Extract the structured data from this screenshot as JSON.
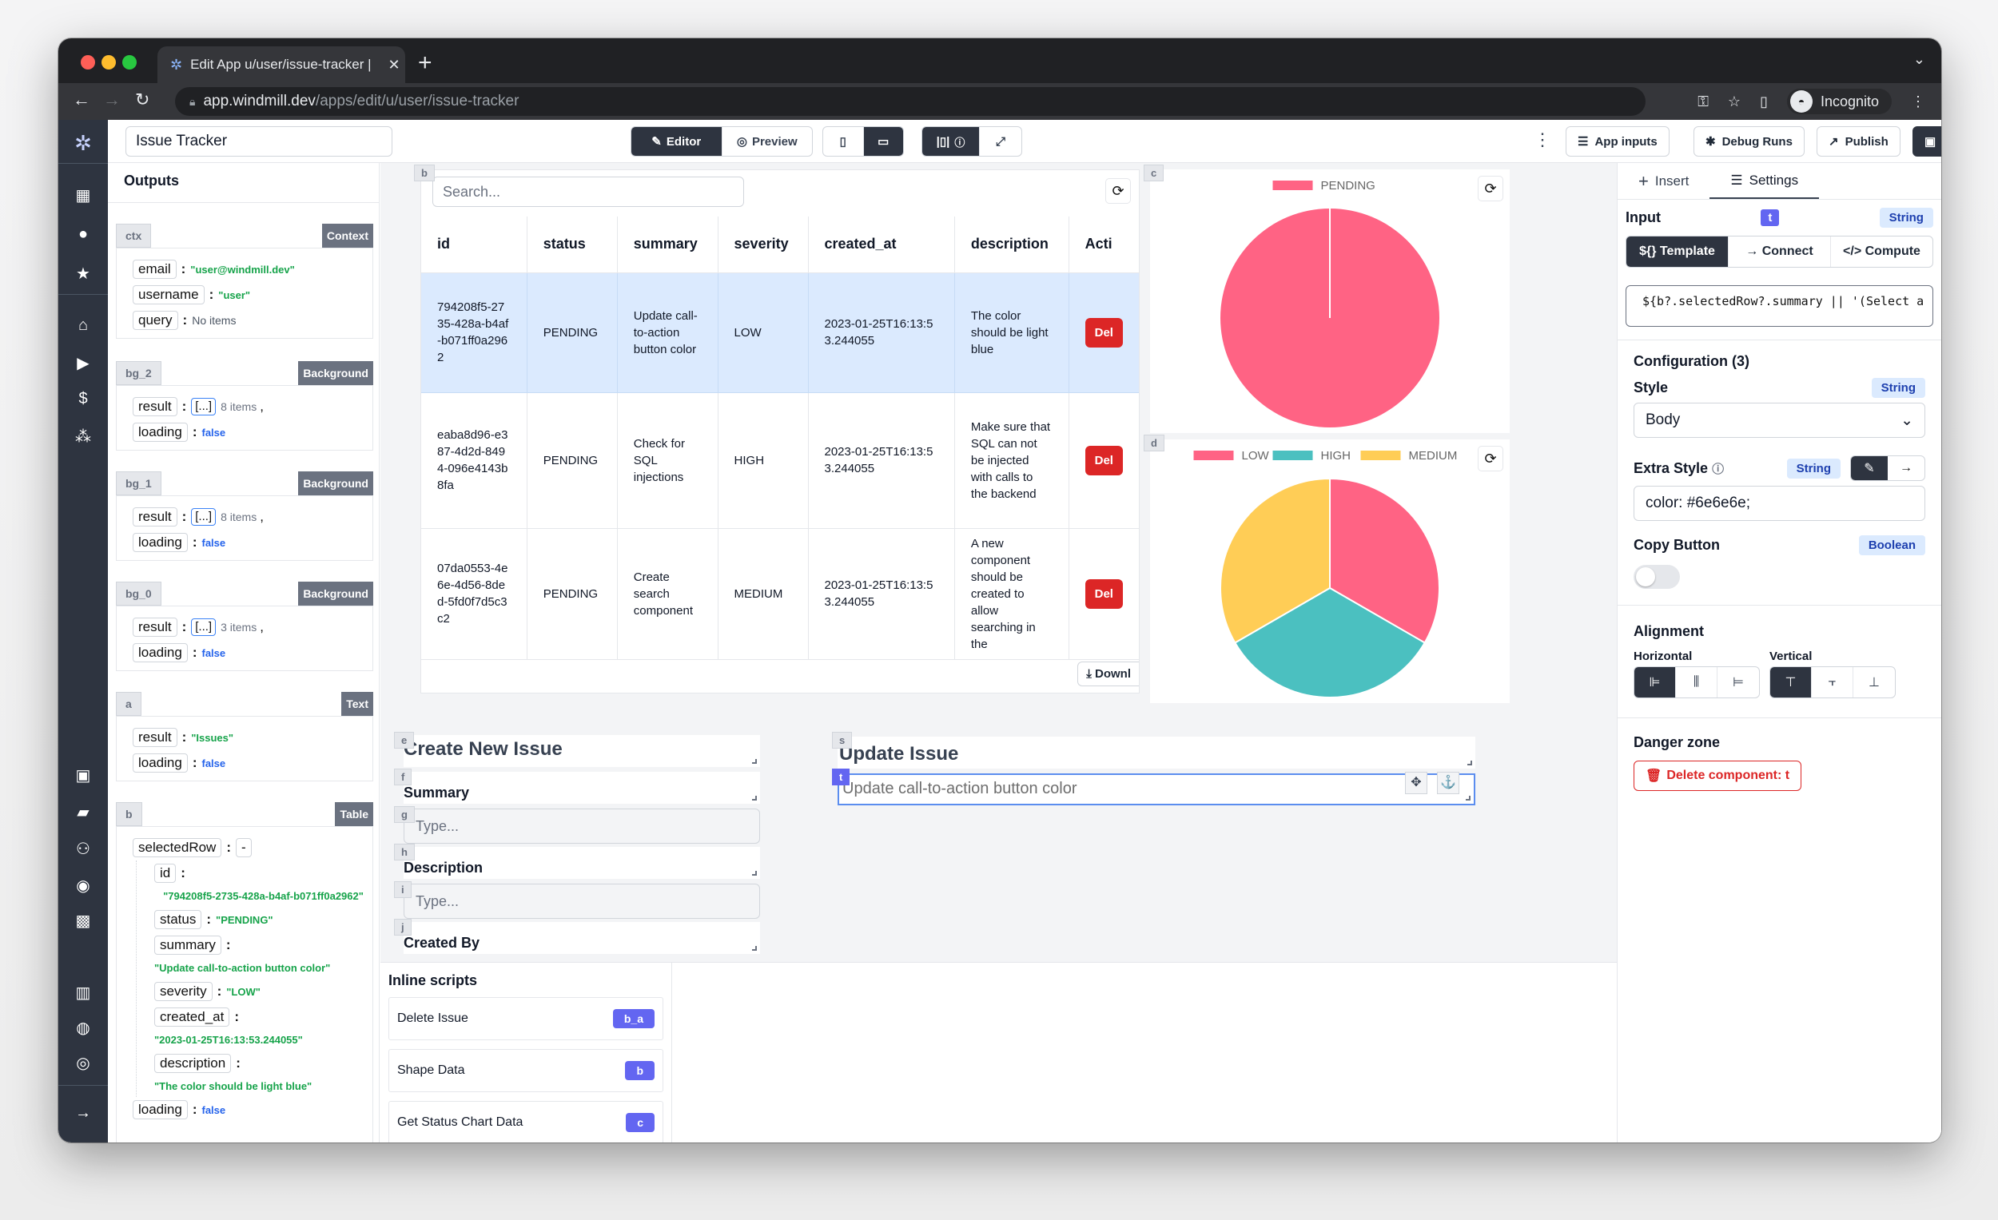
{
  "browser": {
    "tab_title": "Edit App u/user/issue-tracker |",
    "url_host": "app.windmill.dev",
    "url_path": "/apps/edit/u/user/issue-tracker",
    "profile_label": "Incognito"
  },
  "topbar": {
    "app_title": "Issue Tracker",
    "editor_label": "Editor",
    "preview_label": "Preview",
    "app_inputs_label": "App inputs",
    "debug_runs_label": "Debug Runs",
    "publish_label": "Publish",
    "save_label": "Save"
  },
  "outputs": {
    "title": "Outputs",
    "cards": {
      "ctx": {
        "id": "ctx",
        "type": "Context",
        "email_key": "email",
        "email_val": "\"user@windmill.dev\"",
        "username_key": "username",
        "username_val": "\"user\"",
        "query_key": "query",
        "query_val": "No items"
      },
      "bg2": {
        "id": "bg_2",
        "type": "Background",
        "result_key": "result",
        "arr": "[...]",
        "count": "8 items",
        "loading_key": "loading",
        "loading_val": "false"
      },
      "bg1": {
        "id": "bg_1",
        "type": "Background",
        "result_key": "result",
        "arr": "[...]",
        "count": "8 items",
        "loading_key": "loading",
        "loading_val": "false"
      },
      "bg0": {
        "id": "bg_0",
        "type": "Background",
        "result_key": "result",
        "arr": "[...]",
        "count": "3 items",
        "loading_key": "loading",
        "loading_val": "false"
      },
      "a": {
        "id": "a",
        "type": "Text",
        "result_key": "result",
        "result_val": "\"Issues\"",
        "loading_key": "loading",
        "loading_val": "false"
      },
      "b": {
        "id": "b",
        "type": "Table",
        "selected_key": "selectedRow",
        "selected_toggle": "-",
        "id_key": "id",
        "id_val": "\"794208f5-2735-428a-b4af-b071ff0a2962\"",
        "status_key": "status",
        "status_val": "\"PENDING\"",
        "summary_key": "summary",
        "summary_val": "\"Update call-to-action button color\"",
        "severity_key": "severity",
        "severity_val": "\"LOW\"",
        "created_key": "created_at",
        "created_val": "\"2023-01-25T16:13:53.244055\"",
        "description_key": "description",
        "description_val": "\"The color should be light blue\"",
        "loading_key": "loading",
        "loading_val": "false"
      }
    }
  },
  "canvas": {
    "table": {
      "id": "b",
      "search_placeholder": "Search...",
      "columns": [
        "id",
        "status",
        "summary",
        "severity",
        "created_at",
        "description",
        "Acti"
      ],
      "rows": [
        {
          "id": "794208f5-2735-428a-b4af-b071ff0a2962",
          "status": "PENDING",
          "summary": "Update call-to-action button color",
          "severity": "LOW",
          "created_at": "2023-01-25T16:13:53.244055",
          "description": "The color should be light blue",
          "action": "Del",
          "selected": true
        },
        {
          "id": "eaba8d96-e387-4d2d-8494-096e4143b8fa",
          "status": "PENDING",
          "summary": "Check for SQL injections",
          "severity": "HIGH",
          "created_at": "2023-01-25T16:13:53.244055",
          "description": "Make sure that SQL can not be injected with calls to the backend",
          "action": "Del",
          "selected": false
        },
        {
          "id": "07da0553-4e6e-4d56-8ded-5fd0f7d5c3c2",
          "status": "PENDING",
          "summary": "Create search component",
          "severity": "MEDIUM",
          "created_at": "2023-01-25T16:13:53.244055",
          "description": "A new component should be created to allow searching in the",
          "action": "Del",
          "selected": false
        }
      ],
      "download_label": "Downl"
    },
    "create_form": {
      "ids": {
        "e": "e",
        "f": "f",
        "g": "g",
        "h": "h",
        "i": "i",
        "j": "j"
      },
      "title": "Create New Issue",
      "summary_label": "Summary",
      "summary_placeholder": "Type...",
      "description_label": "Description",
      "description_placeholder": "Type...",
      "created_by_label": "Created By"
    },
    "update_form": {
      "ids": {
        "s": "s",
        "t": "t"
      },
      "title": "Update Issue",
      "text_value": "Update call-to-action button color"
    }
  },
  "chart_data": [
    {
      "id": "c",
      "type": "pie",
      "title": "",
      "legend_position": "top",
      "categories": [
        "PENDING"
      ],
      "values": [
        3
      ],
      "colors": [
        "#ff6384"
      ]
    },
    {
      "id": "d",
      "type": "pie",
      "title": "",
      "legend_position": "top",
      "categories": [
        "LOW",
        "HIGH",
        "MEDIUM"
      ],
      "values": [
        1,
        1,
        1
      ],
      "colors": [
        "#ff6384",
        "#4bc0c0",
        "#ffcd56"
      ]
    }
  ],
  "inline_scripts": {
    "title": "Inline scripts",
    "items": [
      {
        "name": "Delete Issue",
        "badge": "b_a"
      },
      {
        "name": "Shape Data",
        "badge": "b"
      },
      {
        "name": "Get Status Chart Data",
        "badge": "c"
      }
    ]
  },
  "settings": {
    "tabs": {
      "insert": "Insert",
      "settings": "Settings"
    },
    "input_label": "Input",
    "component_id": "t",
    "input_type": "String",
    "modes": {
      "template": "${} Template",
      "connect": "→ Connect",
      "compute": "</> Compute"
    },
    "template_code": "${b?.selectedRow?.summary || '(Select a row in",
    "configuration_label": "Configuration (3)",
    "style_label": "Style",
    "style_type": "String",
    "style_value": "Body",
    "extra_style_label": "Extra Style",
    "extra_style_type": "String",
    "extra_style_value": "color: #6e6e6e;",
    "copy_button_label": "Copy Button",
    "copy_button_type": "Boolean",
    "copy_button_on": false,
    "alignment_label": "Alignment",
    "horizontal_label": "Horizontal",
    "vertical_label": "Vertical",
    "danger_label": "Danger zone",
    "delete_label": "Delete component: t"
  }
}
